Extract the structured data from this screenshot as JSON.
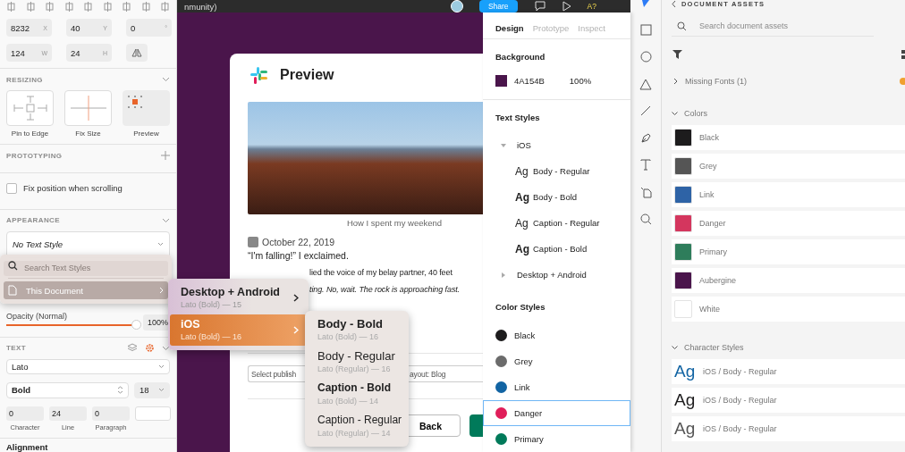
{
  "sketch": {
    "geometry": [
      {
        "value": "8232",
        "axis": "X"
      },
      {
        "value": "40",
        "axis": "Y"
      },
      {
        "value": "0",
        "axis": "°"
      },
      {
        "value": "124",
        "axis": "W"
      },
      {
        "value": "24",
        "axis": "H"
      }
    ],
    "resizing": {
      "title": "RESIZING",
      "options": [
        {
          "label": "Pin to Edge",
          "kind": "pin"
        },
        {
          "label": "Fix Size",
          "kind": "fix"
        },
        {
          "label": "Preview",
          "kind": "preview"
        }
      ]
    },
    "prototyping": {
      "title": "PROTOTYPING",
      "fix_position": {
        "label": "Fix position when scrolling",
        "checked": false
      }
    },
    "appearance": {
      "title": "APPEARANCE",
      "text_style": "No Text Style",
      "opacity_label": "Opacity (Normal)",
      "opacity": {
        "level": 0.97,
        "reading": "100%"
      }
    },
    "text": {
      "title": "TEXT",
      "font": "Lato",
      "weight": "Bold",
      "size": "18",
      "spacing": [
        {
          "value": "0",
          "label": "Character"
        },
        {
          "value": "24",
          "label": "Line"
        },
        {
          "value": "0",
          "label": "Paragraph"
        }
      ]
    },
    "next_section": "Alignment",
    "style_menu": {
      "search_placeholder": "Search Text Styles",
      "source": "This Document",
      "groups": [
        {
          "name": "Desktop + Android",
          "detail": "Lato (Bold) — 15",
          "selected": false
        },
        {
          "name": "iOS",
          "detail": "Lato (Bold) — 16",
          "selected": true
        }
      ],
      "styles": [
        {
          "name": "Body - Bold",
          "detail": "Lato (Bold) — 16",
          "kind": "bold"
        },
        {
          "name": "Body - Regular",
          "detail": "Lato (Regular) — 16",
          "kind": "regular"
        },
        {
          "name": "Caption - Bold",
          "detail": "Lato (Bold) — 14",
          "kind": "bold"
        },
        {
          "name": "Caption - Regular",
          "detail": "Lato (Regular) — 14",
          "kind": "regular"
        }
      ]
    }
  },
  "figma": {
    "title": "nmunity)",
    "share": "Share",
    "badge": "A?",
    "preview": {
      "title": "Preview",
      "caption": "How I spent my weekend",
      "date": "October 22, 2019",
      "lines": [
        {
          "text": "“I'm falling!” I exclaimed.",
          "kind": "plain"
        },
        {
          "text": "lied the voice of my belay partner, 40 feet",
          "kind": "fragment"
        },
        {
          "text": "ting. No, wait. The rock is approaching fast.",
          "kind": "italic"
        }
      ],
      "fields": [
        {
          "value": "Select publish"
        },
        {
          "value": "ayout: Blog"
        }
      ],
      "back": "Back"
    },
    "panel": {
      "tabs": [
        {
          "label": "Design",
          "selected": true
        },
        {
          "label": "Prototype",
          "selected": false
        },
        {
          "label": "Inspect",
          "selected": false
        }
      ],
      "background": {
        "title": "Background",
        "hex": "4A154B",
        "opacity": "100%"
      },
      "text_styles": {
        "title": "Text Styles",
        "groups": [
          {
            "name": "iOS",
            "expanded": true,
            "children": [
              {
                "sample": "Ag",
                "name": "Body - Regular",
                "kind": "regular"
              },
              {
                "sample": "Ag",
                "name": "Body - Bold",
                "kind": "bold"
              },
              {
                "sample": "Ag",
                "name": "Caption - Regular",
                "kind": "regular"
              },
              {
                "sample": "Ag",
                "name": "Caption - Bold",
                "kind": "bold"
              }
            ]
          },
          {
            "name": "Desktop + Android",
            "expanded": false
          }
        ]
      },
      "color_styles": {
        "title": "Color Styles",
        "items": [
          {
            "name": "Black",
            "color": "#1d1c1d",
            "selected": false
          },
          {
            "name": "Grey",
            "color": "#6b6b6b",
            "selected": false
          },
          {
            "name": "Link",
            "color": "#1264a3",
            "selected": false
          },
          {
            "name": "Danger",
            "color": "#e01e5a",
            "selected": true
          },
          {
            "name": "Primary",
            "color": "#007a5a",
            "selected": false
          }
        ]
      }
    }
  },
  "xd": {
    "title": "DOCUMENT ASSETS",
    "search_placeholder": "Search document assets",
    "missing_fonts": {
      "label": "Missing Fonts (1)",
      "expanded": false
    },
    "colors": {
      "title": "Colors",
      "expanded": true,
      "items": [
        {
          "name": "Black",
          "color": "#1d1c1d"
        },
        {
          "name": "Grey",
          "color": "#555555"
        },
        {
          "name": "Link",
          "color": "#2e63a6"
        },
        {
          "name": "Danger",
          "color": "#d4365e"
        },
        {
          "name": "Primary",
          "color": "#2e7d5b"
        },
        {
          "name": "Aubergine",
          "color": "#4a154b"
        },
        {
          "name": "White",
          "color": "#ffffff"
        }
      ]
    },
    "character_styles": {
      "title": "Character Styles",
      "expanded": true,
      "items": [
        {
          "sample": "Ag",
          "name": "iOS / Body - Regular",
          "color": "#1264a3"
        },
        {
          "sample": "Ag",
          "name": "iOS / Body - Regular",
          "color": "#1d1c1d"
        },
        {
          "sample": "Ag",
          "name": "iOS / Body - Regular",
          "color": "#555555"
        }
      ]
    }
  }
}
